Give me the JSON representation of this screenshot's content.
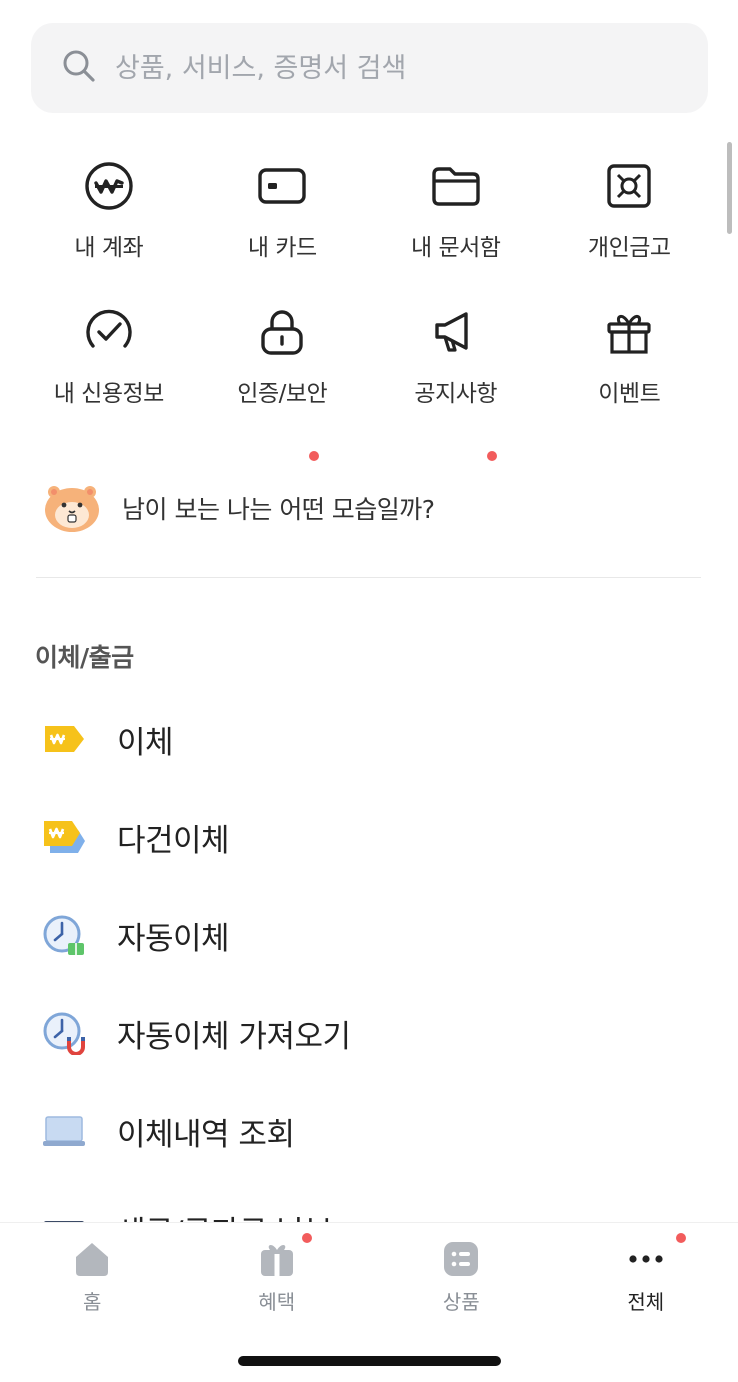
{
  "search": {
    "placeholder": "상품, 서비스, 증명서 검색",
    "icon": "search-icon"
  },
  "quick_menu": [
    {
      "label": "내 계좌",
      "icon": "won-circle-icon",
      "new_dot": false
    },
    {
      "label": "내 카드",
      "icon": "card-icon",
      "new_dot": false
    },
    {
      "label": "내 문서함",
      "icon": "folder-icon",
      "new_dot": false
    },
    {
      "label": "개인금고",
      "icon": "safe-icon",
      "new_dot": false
    },
    {
      "label": "내 신용정보",
      "icon": "credit-check-icon",
      "new_dot": false
    },
    {
      "label": "인증/보안",
      "icon": "lock-icon",
      "new_dot": true
    },
    {
      "label": "공지사항",
      "icon": "megaphone-icon",
      "new_dot": true
    },
    {
      "label": "이벤트",
      "icon": "gift-icon",
      "new_dot": false
    }
  ],
  "banner": {
    "text": "남이 보는 나는 어떤 모습일까?",
    "icon": "hamster-icon"
  },
  "section": {
    "title": "이체/출금",
    "items": [
      {
        "label": "이체",
        "icon": "transfer-tag-icon"
      },
      {
        "label": "다건이체",
        "icon": "multi-transfer-icon"
      },
      {
        "label": "자동이체",
        "icon": "auto-transfer-clock-icon"
      },
      {
        "label": "자동이체 가져오기",
        "icon": "auto-transfer-magnet-icon"
      },
      {
        "label": "이체내역 조회",
        "icon": "history-laptop-icon"
      },
      {
        "label": "세금/공과금 납부",
        "icon": "tax-receipt-icon"
      }
    ]
  },
  "tabbar": {
    "items": [
      {
        "label": "홈",
        "icon": "home-icon",
        "active": false,
        "new_dot": false
      },
      {
        "label": "혜택",
        "icon": "gift-box-icon",
        "active": false,
        "new_dot": true
      },
      {
        "label": "상품",
        "icon": "product-list-icon",
        "active": false,
        "new_dot": false
      },
      {
        "label": "전체",
        "icon": "more-dots-icon",
        "active": true,
        "new_dot": true
      }
    ]
  },
  "colors": {
    "notification_dot": "#f25c5c",
    "accent_yellow": "#f6c21a",
    "inactive_tab": "#8a8f96"
  }
}
